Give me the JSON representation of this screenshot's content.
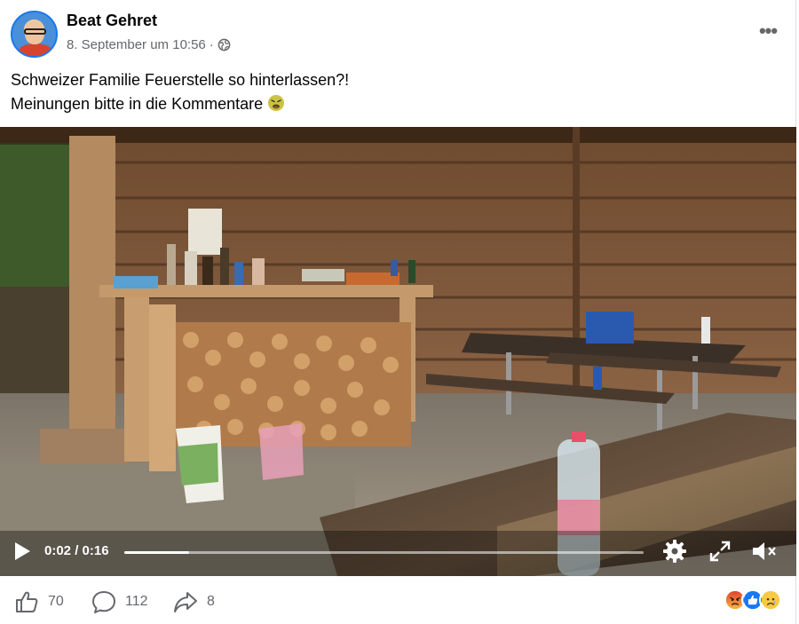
{
  "post": {
    "author": "Beat Gehret",
    "timestamp": "8. September um 10:56",
    "separator": "·",
    "privacy_icon": "globe-icon",
    "text_line1": "Schweizer Familie Feuerstelle so hinterlassen?!",
    "text_line2": "Meinungen bitte in die Kommentare"
  },
  "video": {
    "current_time": "0:02",
    "duration": "0:16",
    "time_display": "0:02 / 0:16",
    "progress": 0.125
  },
  "footer": {
    "likes": "70",
    "comments": "112",
    "shares": "8",
    "reaction_icons": [
      "angry-icon",
      "like-icon",
      "sad-icon"
    ]
  },
  "colors": {
    "brand_blue": "#1877f2",
    "secondary_text": "#65676b"
  }
}
